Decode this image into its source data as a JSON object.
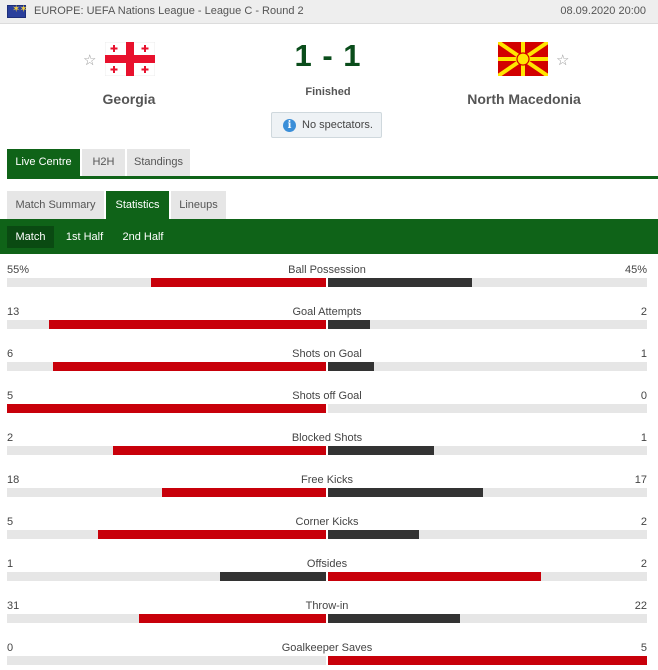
{
  "header": {
    "league": "EUROPE: UEFA Nations League - League C - Round 2",
    "date": "08.09.2020 20:00"
  },
  "match": {
    "home": "Georgia",
    "away": "North Macedonia",
    "score": "1 - 1",
    "status": "Finished",
    "info": "No spectators."
  },
  "tabs": [
    "Live Centre",
    "H2H",
    "Standings"
  ],
  "sub_tabs": [
    "Match Summary",
    "Statistics",
    "Lineups"
  ],
  "periods": [
    "Match",
    "1st Half",
    "2nd Half"
  ],
  "colors": {
    "green": "#0f6318",
    "home_win": "#c8000a",
    "loser": "#333333"
  },
  "stats": [
    {
      "name": "Ball Possession",
      "home": "55%",
      "away": "45%",
      "home_frac": 0.55,
      "away_frac": 0.45
    },
    {
      "name": "Goal Attempts",
      "home": "13",
      "away": "2",
      "home_frac": 0.867,
      "away_frac": 0.133
    },
    {
      "name": "Shots on Goal",
      "home": "6",
      "away": "1",
      "home_frac": 0.857,
      "away_frac": 0.143
    },
    {
      "name": "Shots off Goal",
      "home": "5",
      "away": "0",
      "home_frac": 1.0,
      "away_frac": 0.0
    },
    {
      "name": "Blocked Shots",
      "home": "2",
      "away": "1",
      "home_frac": 0.667,
      "away_frac": 0.333
    },
    {
      "name": "Free Kicks",
      "home": "18",
      "away": "17",
      "home_frac": 0.514,
      "away_frac": 0.486
    },
    {
      "name": "Corner Kicks",
      "home": "5",
      "away": "2",
      "home_frac": 0.714,
      "away_frac": 0.286
    },
    {
      "name": "Offsides",
      "home": "1",
      "away": "2",
      "home_frac": 0.333,
      "away_frac": 0.667
    },
    {
      "name": "Throw-in",
      "home": "31",
      "away": "22",
      "home_frac": 0.585,
      "away_frac": 0.415
    },
    {
      "name": "Goalkeeper Saves",
      "home": "0",
      "away": "5",
      "home_frac": 0.0,
      "away_frac": 1.0
    }
  ]
}
